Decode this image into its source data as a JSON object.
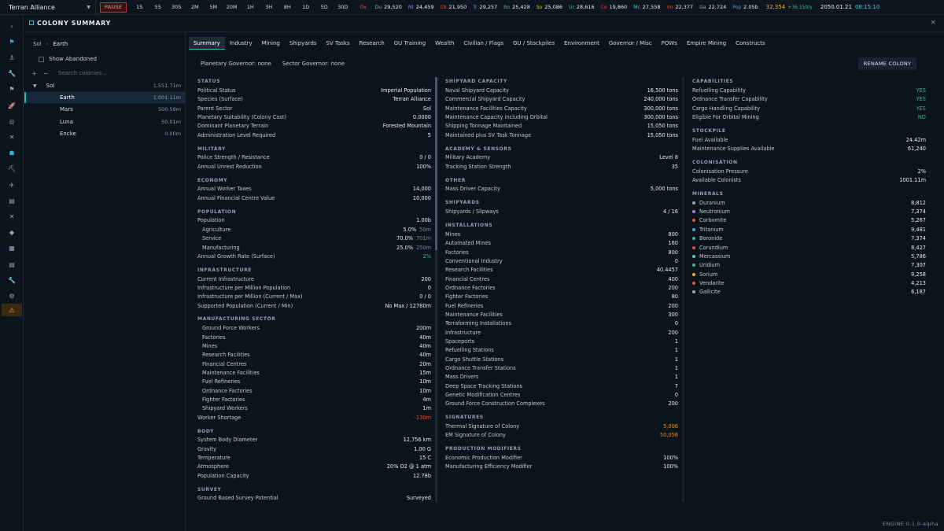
{
  "topbar": {
    "faction": "Terran Alliance",
    "pause_label": "PAUSE",
    "time_steps": [
      "1S",
      "5S",
      "30S",
      "2M",
      "5M",
      "20M",
      "1H",
      "3H",
      "8H",
      "1D",
      "5D",
      "30D"
    ],
    "resources": [
      {
        "code": "Ox",
        "value": "",
        "color": "#e0533d"
      },
      {
        "code": "Du",
        "value": "29,520",
        "color": "#9aa7b5"
      },
      {
        "code": "Nt",
        "value": "24,459",
        "color": "#b07ad8"
      },
      {
        "code": "Cb",
        "value": "21,950",
        "color": "#e0533d"
      },
      {
        "code": "Tr",
        "value": "29,257",
        "color": "#4aa3e0"
      },
      {
        "code": "Bo",
        "value": "25,428",
        "color": "#43b78a"
      },
      {
        "code": "So",
        "value": "25,086",
        "color": "#e0b23d"
      },
      {
        "code": "Ur",
        "value": "28,616",
        "color": "#43b78a"
      },
      {
        "code": "Co",
        "value": "19,860",
        "color": "#e0533d"
      },
      {
        "code": "Mc",
        "value": "27,558",
        "color": "#48d0cf"
      },
      {
        "code": "Vn",
        "value": "22,377",
        "color": "#e0533d"
      },
      {
        "code": "Ga",
        "value": "22,724",
        "color": "#9aa7b5"
      },
      {
        "code": "Pop",
        "value": "2.05b",
        "color": "#4aa3e0"
      }
    ],
    "wealth": {
      "value": "32,354",
      "delta": "+36,150/y",
      "color": "#e0b23d",
      "delta_color": "#43b78a"
    },
    "date": "2050.01.21",
    "clock": "08:15:10"
  },
  "panel": {
    "title": "COLONY SUMMARY",
    "close": "×"
  },
  "tree": {
    "breadcrumb": [
      "Sol",
      "Earth"
    ],
    "show_abandoned": "Show Abandoned",
    "search_placeholder": "Search colonies...",
    "system": {
      "name": "Sol",
      "value": "1,551.71m"
    },
    "colonies": [
      {
        "name": "Earth",
        "value": "1,001.11m",
        "selected": true
      },
      {
        "name": "Mars",
        "value": "500.59m",
        "selected": false
      },
      {
        "name": "Luna",
        "value": "50.01m",
        "selected": false
      },
      {
        "name": "Encke",
        "value": "0.00m",
        "selected": false
      }
    ]
  },
  "tabs": [
    "Summary",
    "Industry",
    "Mining",
    "Shipyards",
    "SV Tasks",
    "Research",
    "GU Training",
    "Wealth",
    "Civilian / Flags",
    "GU / Stockpiles",
    "Environment",
    "Governor / Misc",
    "POWs",
    "Empire Mining",
    "Constructs"
  ],
  "governors": {
    "planetary": "Planetary Governor: none",
    "sector": "Sector Governor: none"
  },
  "rename_label": "RENAME COLONY",
  "columns": [
    [
      {
        "h": "STATUS"
      },
      {
        "l": "Political Status",
        "v": "Imperial Population"
      },
      {
        "l": "Species (Surface)",
        "v": "Terran Alliance"
      },
      {
        "l": "Parent Sector",
        "v": "Sol"
      },
      {
        "l": "Planetary Suitability (Colony Cost)",
        "v": "0.0000"
      },
      {
        "l": "Dominant Planetary Terrain",
        "v": "Forested Mountain"
      },
      {
        "l": "Administration Level Required",
        "v": "5"
      },
      {
        "h": "MILITARY"
      },
      {
        "l": "Police Strength / Resistance",
        "v": "0 / 0"
      },
      {
        "l": "Annual Unrest Reduction",
        "v": "100%"
      },
      {
        "h": "ECONOMY"
      },
      {
        "l": "Annual Worker Taxes",
        "v": "14,000"
      },
      {
        "l": "Annual Financial Centre Value",
        "v": "10,000"
      },
      {
        "h": "POPULATION"
      },
      {
        "l": "Population",
        "v": "1.00b"
      },
      {
        "l": "Agriculture",
        "v": "5.0%",
        "m": "50m",
        "sub": true
      },
      {
        "l": "Service",
        "v": "70.0%",
        "m": "701m",
        "sub": true
      },
      {
        "l": "Manufacturing",
        "v": "25.0%",
        "m": "250m",
        "sub": true
      },
      {
        "l": "Annual Growth Rate (Surface)",
        "v": "2%",
        "c": "green"
      },
      {
        "h": "INFRASTRUCTURE"
      },
      {
        "l": "Current Infrastructure",
        "v": "200"
      },
      {
        "l": "Infrastructure per Million Population",
        "v": "0"
      },
      {
        "l": "Infrastructure per Million (Current / Max)",
        "v": "0 / 0"
      },
      {
        "l": "Supported Population (Current / Min)",
        "v": "No Max / 12780m"
      },
      {
        "h": "MANUFACTURING SECTOR"
      },
      {
        "l": "Ground Force Workers",
        "v": "200m",
        "sub": true
      },
      {
        "l": "Factories",
        "v": "40m",
        "sub": true
      },
      {
        "l": "Mines",
        "v": "40m",
        "sub": true
      },
      {
        "l": "Research Facilities",
        "v": "40m",
        "sub": true
      },
      {
        "l": "Financial Centres",
        "v": "20m",
        "sub": true
      },
      {
        "l": "Maintenance Facilities",
        "v": "15m",
        "sub": true
      },
      {
        "l": "Fuel Refineries",
        "v": "10m",
        "sub": true
      },
      {
        "l": "Ordnance Factories",
        "v": "10m",
        "sub": true
      },
      {
        "l": "Fighter Factories",
        "v": "4m",
        "sub": true
      },
      {
        "l": "Shipyard Workers",
        "v": "1m",
        "sub": true
      },
      {
        "l": "Worker Shortage",
        "v": "-130m",
        "c": "red"
      },
      {
        "h": "BODY"
      },
      {
        "l": "System Body Diameter",
        "v": "12,756 km"
      },
      {
        "l": "Gravity",
        "v": "1.00 G"
      },
      {
        "l": "Temperature",
        "v": "15 C"
      },
      {
        "l": "Atmosphere",
        "v": "20% O2 @ 1 atm"
      },
      {
        "l": "Population Capacity",
        "v": "12.78b"
      },
      {
        "h": "SURVEY"
      },
      {
        "l": "Ground Based Survey Potential",
        "v": "Surveyed"
      }
    ],
    [
      {
        "h": "SHIPYARD CAPACITY"
      },
      {
        "l": "Naval Shipyard Capacity",
        "v": "16,500 tons"
      },
      {
        "l": "Commercial Shipyard Capacity",
        "v": "240,000 tons"
      },
      {
        "l": "Maintenance Facilities Capacity",
        "v": "300,000 tons"
      },
      {
        "l": "Maintenance Capacity including Orbital",
        "v": "300,000 tons"
      },
      {
        "l": "Shipping Tonnage Maintained",
        "v": "15,050 tons"
      },
      {
        "l": "Maintained plus SV Task Tonnage",
        "v": "15,050 tons"
      },
      {
        "h": "ACADEMY & SENSORS"
      },
      {
        "l": "Military Academy",
        "v": "Level 8"
      },
      {
        "l": "Tracking Station Strength",
        "v": "35"
      },
      {
        "h": "OTHER"
      },
      {
        "l": "Mass Driver Capacity",
        "v": "5,000 tons"
      },
      {
        "h": "SHIPYARDS"
      },
      {
        "l": "Shipyards / Slipways",
        "v": "4 / 16"
      },
      {
        "h": "INSTALLATIONS"
      },
      {
        "l": "Mines",
        "v": "800"
      },
      {
        "l": "Automated Mines",
        "v": "160"
      },
      {
        "l": "Factories",
        "v": "800"
      },
      {
        "l": "Conventional Industry",
        "v": "0"
      },
      {
        "l": "Research Facilities",
        "v": "40.4457"
      },
      {
        "l": "Financial Centres",
        "v": "400"
      },
      {
        "l": "Ordnance Factories",
        "v": "200"
      },
      {
        "l": "Fighter Factories",
        "v": "80"
      },
      {
        "l": "Fuel Refineries",
        "v": "200"
      },
      {
        "l": "Maintenance Facilities",
        "v": "300"
      },
      {
        "l": "Terraforming Installations",
        "v": "0"
      },
      {
        "l": "Infrastructure",
        "v": "200"
      },
      {
        "l": "Spaceports",
        "v": "1"
      },
      {
        "l": "Refuelling Stations",
        "v": "1"
      },
      {
        "l": "Cargo Shuttle Stations",
        "v": "1"
      },
      {
        "l": "Ordnance Transfer Stations",
        "v": "1"
      },
      {
        "l": "Mass Drivers",
        "v": "1"
      },
      {
        "l": "Deep Space Tracking Stations",
        "v": "7"
      },
      {
        "l": "Genetic Modification Centres",
        "v": "0"
      },
      {
        "l": "Ground Force Construction Complexes",
        "v": "200"
      },
      {
        "h": "SIGNATURES"
      },
      {
        "l": "Thermal Signature of Colony",
        "v": "5,006",
        "c": "orange"
      },
      {
        "l": "EM Signature of Colony",
        "v": "50,056",
        "c": "orange"
      },
      {
        "h": "PRODUCTION MODIFIERS"
      },
      {
        "l": "Economic Production Modifier",
        "v": "100%"
      },
      {
        "l": "Manufacturing Efficiency Modifier",
        "v": "100%"
      }
    ],
    [
      {
        "h": "CAPABILITIES"
      },
      {
        "l": "Refuelling Capability",
        "v": "YES",
        "c": "green"
      },
      {
        "l": "Ordnance Transfer Capability",
        "v": "YES",
        "c": "green"
      },
      {
        "l": "Cargo Handling Capability",
        "v": "YES",
        "c": "green"
      },
      {
        "l": "Eligible For Orbital Mining",
        "v": "NO",
        "c": "green"
      },
      {
        "h": "STOCKPILE"
      },
      {
        "l": "Fuel Available",
        "v": "24.42m"
      },
      {
        "l": "Maintenance Supplies Available",
        "v": "61,240"
      },
      {
        "h": "COLONISATION"
      },
      {
        "l": "Colonisation Pressure",
        "v": "2%"
      },
      {
        "l": "Available Colonists",
        "v": "1001.11m"
      },
      {
        "h": "MINERALS"
      },
      {
        "l": "Duranium",
        "v": "8,812",
        "dot": "#9aa7b5"
      },
      {
        "l": "Neutronium",
        "v": "7,374",
        "dot": "#b07ad8"
      },
      {
        "l": "Corbomite",
        "v": "5,267",
        "dot": "#e0533d"
      },
      {
        "l": "Tritanium",
        "v": "9,481",
        "dot": "#4aa3e0"
      },
      {
        "l": "Boronide",
        "v": "7,374",
        "dot": "#43b78a"
      },
      {
        "l": "Corundium",
        "v": "8,427",
        "dot": "#e0533d"
      },
      {
        "l": "Mercassium",
        "v": "5,786",
        "dot": "#48d0cf"
      },
      {
        "l": "Uridium",
        "v": "7,307",
        "dot": "#43b78a"
      },
      {
        "l": "Sorium",
        "v": "9,258",
        "dot": "#e0b23d"
      },
      {
        "l": "Vendarite",
        "v": "4,213",
        "dot": "#e0533d"
      },
      {
        "l": "Gallicite",
        "v": "6,187",
        "dot": "#9aa7b5"
      }
    ]
  ],
  "rail_icons": [
    "chevron-right-icon",
    "flag-icon",
    "anchor-icon",
    "wrench-icon",
    "flag-small-icon",
    "rocket-icon",
    "target-icon",
    "swords-icon",
    "person-icon",
    "pickaxe-icon",
    "satellite-icon",
    "clipboard-icon",
    "close-swords-icon",
    "tag-icon",
    "box-icon",
    "list-icon",
    "tool-icon",
    "gear-icon",
    "warning-icon"
  ],
  "footer": "ENGINE  0.1.0-alpha"
}
